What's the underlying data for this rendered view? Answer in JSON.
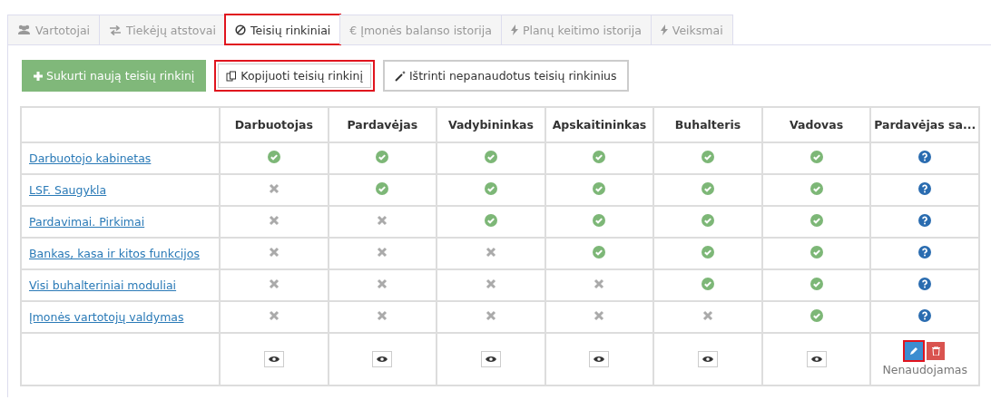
{
  "tabs": [
    {
      "label": "Vartotojai",
      "kind": "users",
      "selected": false,
      "highlighted": false
    },
    {
      "label": "Tiekėjų atstovai",
      "kind": "exchange",
      "selected": false,
      "highlighted": false
    },
    {
      "label": "Teisių rinkiniai",
      "kind": "ban",
      "selected": true,
      "highlighted": true
    },
    {
      "label": "€ Įmonės balanso istorija",
      "kind": "plain",
      "selected": false,
      "highlighted": false
    },
    {
      "label": "Planų keitimo istorija",
      "kind": "bolt",
      "selected": false,
      "highlighted": false
    },
    {
      "label": "Veiksmai",
      "kind": "bolt",
      "selected": false,
      "highlighted": false
    }
  ],
  "toolbar": [
    {
      "label": "Sukurti naują teisių rinkinį",
      "kind": "create",
      "highlighted": false
    },
    {
      "label": "Kopijuoti teisių rinkinį",
      "kind": "copy",
      "highlighted": true
    },
    {
      "label": "Ištrinti nepanaudotus teisių rinkinius",
      "kind": "wand",
      "highlighted": false
    }
  ],
  "table": {
    "columns": [
      "Darbuotojas",
      "Pardavėjas",
      "Vadybininkas",
      "Apskaitininkas",
      "Buhalteris",
      "Vadovas",
      "Pardavėjas sa..."
    ],
    "rows": [
      {
        "name": "Darbuotojo kabinetas",
        "cells": [
          {
            "kind": "yes"
          },
          {
            "kind": "yes"
          },
          {
            "kind": "yes"
          },
          {
            "kind": "yes"
          },
          {
            "kind": "yes"
          },
          {
            "kind": "yes"
          },
          {
            "kind": "unknown"
          }
        ]
      },
      {
        "name": "LSF. Saugykla",
        "cells": [
          {
            "kind": "no"
          },
          {
            "kind": "yes"
          },
          {
            "kind": "yes"
          },
          {
            "kind": "yes"
          },
          {
            "kind": "yes"
          },
          {
            "kind": "yes"
          },
          {
            "kind": "unknown"
          }
        ]
      },
      {
        "name": "Pardavimai. Pirkimai",
        "cells": [
          {
            "kind": "no"
          },
          {
            "kind": "no"
          },
          {
            "kind": "yes"
          },
          {
            "kind": "yes"
          },
          {
            "kind": "yes"
          },
          {
            "kind": "yes"
          },
          {
            "kind": "unknown"
          }
        ]
      },
      {
        "name": "Bankas, kasa ir kitos funkcijos",
        "cells": [
          {
            "kind": "no"
          },
          {
            "kind": "no"
          },
          {
            "kind": "no"
          },
          {
            "kind": "yes"
          },
          {
            "kind": "yes"
          },
          {
            "kind": "yes"
          },
          {
            "kind": "unknown"
          }
        ]
      },
      {
        "name": "Visi buhalteriniai moduliai",
        "cells": [
          {
            "kind": "no"
          },
          {
            "kind": "no"
          },
          {
            "kind": "no"
          },
          {
            "kind": "no"
          },
          {
            "kind": "yes"
          },
          {
            "kind": "yes"
          },
          {
            "kind": "unknown"
          }
        ]
      },
      {
        "name": "Įmonės vartotojų valdymas",
        "cells": [
          {
            "kind": "no"
          },
          {
            "kind": "no"
          },
          {
            "kind": "no"
          },
          {
            "kind": "no"
          },
          {
            "kind": "no"
          },
          {
            "kind": "yes"
          },
          {
            "kind": "unknown"
          }
        ]
      }
    ],
    "footer": [
      {
        "kind": "view"
      },
      {
        "kind": "view"
      },
      {
        "kind": "view"
      },
      {
        "kind": "view"
      },
      {
        "kind": "view"
      },
      {
        "kind": "view"
      },
      {
        "kind": "edit",
        "edit_highlighted": true,
        "status": "Nenaudojamas"
      }
    ]
  }
}
